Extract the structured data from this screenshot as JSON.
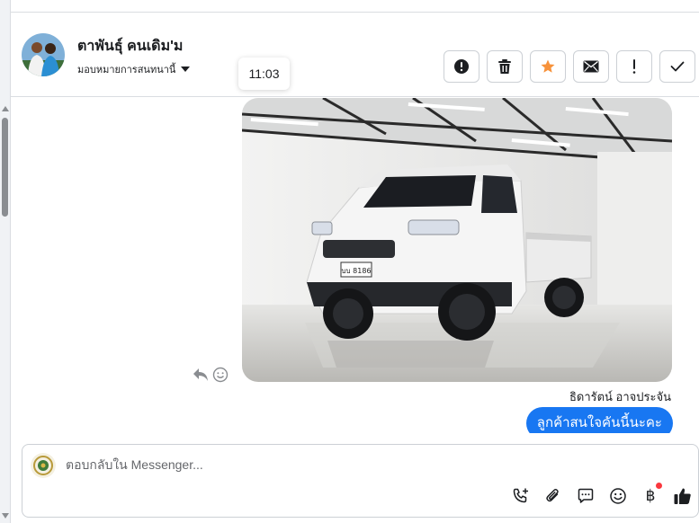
{
  "header": {
    "contact_name": "ตาพันธุ์ คนเดิม'ม",
    "assign_label": "มอบหมายการสนทนานี้",
    "avatar_icon": "contact-avatar",
    "actions": [
      {
        "name": "report-button",
        "icon": "alert-circle-icon"
      },
      {
        "name": "delete-button",
        "icon": "trash-icon"
      },
      {
        "name": "star-button",
        "icon": "star-icon",
        "color": "#f7923b"
      },
      {
        "name": "mark-unread-button",
        "icon": "envelope-icon"
      },
      {
        "name": "flag-button",
        "icon": "exclamation-icon"
      },
      {
        "name": "done-button",
        "icon": "check-icon"
      }
    ]
  },
  "tooltip": {
    "time": "11:03"
  },
  "conversation": {
    "photo_plate": "บบ 8186",
    "sender_name": "ธิดารัตน์ อาจประจัน",
    "message_text": "ลูกค้าสนใจคันนี้นะคะ"
  },
  "composer": {
    "placeholder": "ตอบกลับใน Messenger...",
    "tools": [
      "phone-plus-icon",
      "paperclip-icon",
      "chat-bubble-icon",
      "emoji-icon",
      "baht-icon",
      "thumbs-up-icon"
    ],
    "baht_symbol": "฿"
  },
  "colors": {
    "accent": "#1877f2",
    "star": "#f7923b",
    "notification": "#fa383e"
  }
}
